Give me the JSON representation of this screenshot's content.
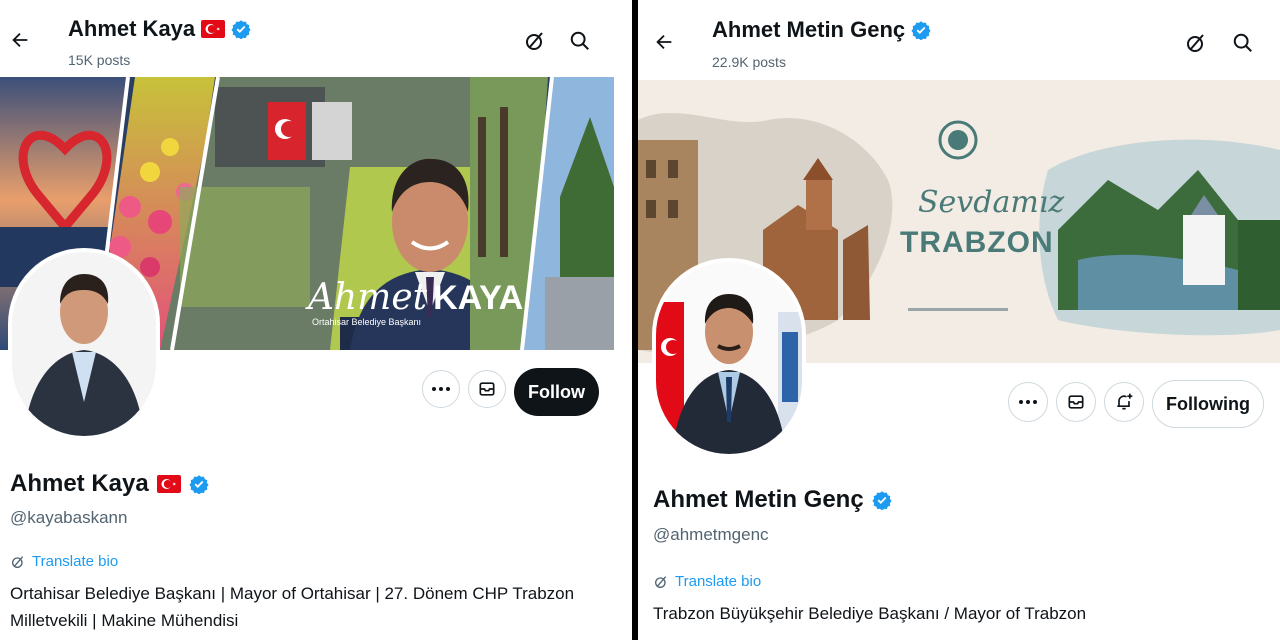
{
  "left": {
    "header": {
      "name": "Ahmet Kaya",
      "posts": "15K posts"
    },
    "banner": {
      "script_text": "Ahmet",
      "bold_text": "KAYA",
      "caption": "Ortahisar Belediye Başkanı"
    },
    "actions": {
      "follow_label": "Follow"
    },
    "profile": {
      "name": "Ahmet Kaya",
      "handle": "@kayabaskann",
      "translate_label": "Translate bio",
      "bio_line1": "Ortahisar Belediye Başkanı | Mayor of Ortahisar | 27. Dönem CHP Trabzon",
      "bio_line2": "Milletvekili | Makine Mühendisi"
    }
  },
  "right": {
    "header": {
      "name": "Ahmet Metin Genç",
      "posts": "22.9K posts"
    },
    "banner": {
      "script_text": "Sevdamız",
      "bold_text": "TRABZON"
    },
    "actions": {
      "following_label": "Following"
    },
    "profile": {
      "name": "Ahmet Metin Genç",
      "handle": "@ahmetmgenc",
      "translate_label": "Translate bio",
      "bio_line1": "Trabzon Büyükşehir Belediye Başkanı / Mayor of Trabzon"
    }
  },
  "icons": {
    "back": "arrow-left-icon",
    "grok": "grok-icon",
    "search": "search-icon",
    "more": "more-icon",
    "message": "message-icon",
    "notify": "bell-plus-icon",
    "verified": "verified-badge-icon",
    "flag": "turkey-flag-icon",
    "translate": "translate-icon"
  },
  "colors": {
    "verified_blue": "#1d9bf0",
    "flag_red": "#e30a17",
    "follow_dark": "#0f1419",
    "muted": "#536471"
  }
}
